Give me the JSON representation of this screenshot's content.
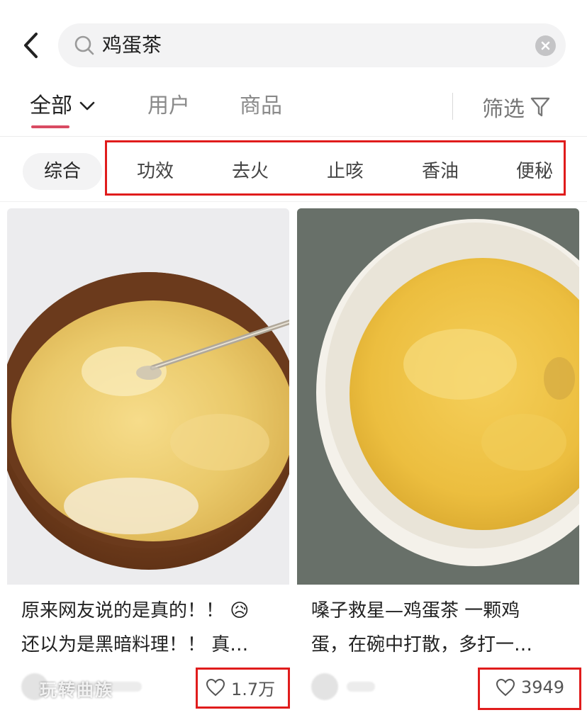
{
  "search": {
    "query": "鸡蛋茶"
  },
  "tabs": [
    {
      "label": "全部",
      "active": true
    },
    {
      "label": "用户",
      "active": false
    },
    {
      "label": "商品",
      "active": false
    }
  ],
  "filter": {
    "label": "筛选"
  },
  "chips": {
    "active": "综合",
    "items": [
      "功效",
      "去火",
      "止咳",
      "香油",
      "便秘"
    ]
  },
  "cards": [
    {
      "title_line1": "原来网友说的是真的！！",
      "title_emoji": "😥",
      "title_line2": "还以为是黑暗料理！！ 真…",
      "likes": "1.7万"
    },
    {
      "title_line1": "嗓子救星—鸡蛋茶 一颗鸡",
      "title_line2": "蛋，在碗中打散，多打一…",
      "likes": "3949"
    }
  ],
  "watermark": "玩转曲族",
  "colors": {
    "accent": "#d94a62",
    "highlight": "#e01c1c",
    "search_bg": "#f3f3f4"
  }
}
